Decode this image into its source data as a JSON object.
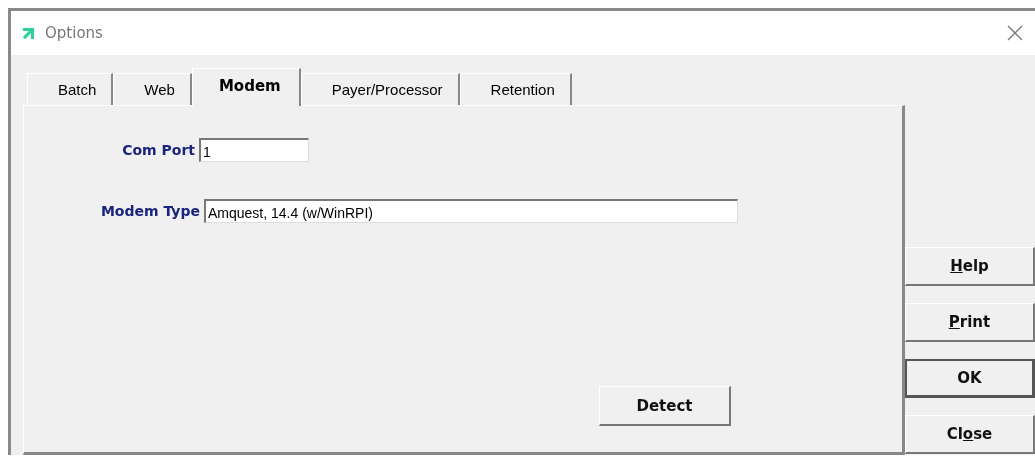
{
  "window": {
    "title": "Options"
  },
  "tabs": [
    {
      "label": "Batch",
      "selected": false
    },
    {
      "label": "Web",
      "selected": false
    },
    {
      "label": "Modem",
      "selected": true
    },
    {
      "label": "Payer/Processor",
      "selected": false
    },
    {
      "label": "Retention",
      "selected": false
    }
  ],
  "fields": [
    {
      "label": "Com Port",
      "value": "1",
      "kind": "short"
    },
    {
      "label": "Modem Type",
      "value": "Amquest, 14.4 (w/WinRPI)",
      "kind": "long"
    }
  ],
  "detect_button": {
    "label": "Detect"
  },
  "side_buttons": [
    {
      "key": "H",
      "post": "elp",
      "default": false
    },
    {
      "key": "P",
      "post": "rint",
      "default": false
    },
    {
      "pre": "OK",
      "default": true
    },
    {
      "pre": "Cl",
      "key": "o",
      "post": "se",
      "default": false
    }
  ]
}
